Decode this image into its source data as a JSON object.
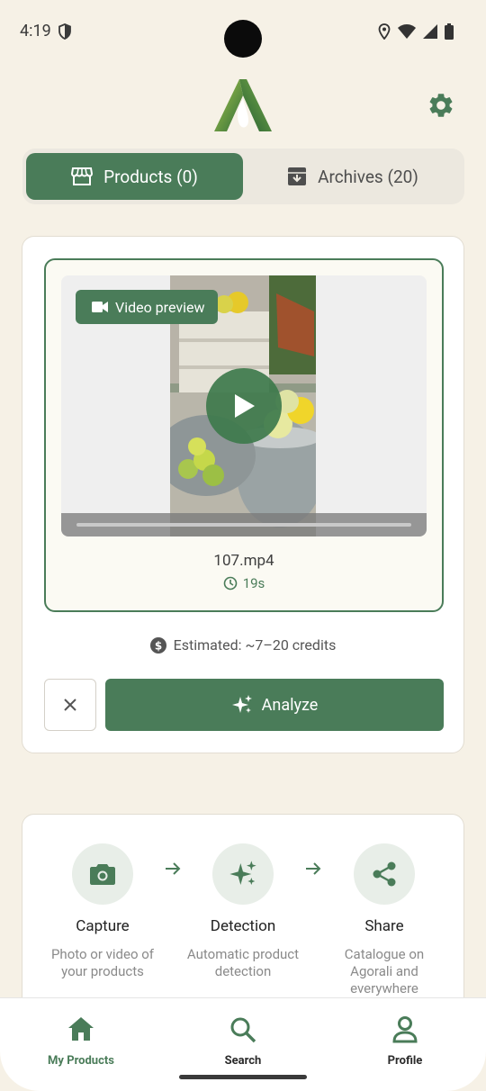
{
  "status_bar": {
    "time": "4:19"
  },
  "tabs": [
    {
      "label": "Products (0)",
      "icon": "storefront-icon",
      "active": true
    },
    {
      "label": "Archives (20)",
      "icon": "archive-icon",
      "active": false
    }
  ],
  "upload": {
    "badge_label": "Video preview",
    "filename": "107.mp4",
    "duration": "19s",
    "estimate": "Estimated: ~7–20 credits",
    "analyze_label": "Analyze"
  },
  "steps": [
    {
      "title": "Capture",
      "desc": "Photo or video of your products",
      "icon": "camera-icon"
    },
    {
      "title": "Detection",
      "desc": "Automatic product detection",
      "icon": "sparkle-icon"
    },
    {
      "title": "Share",
      "desc": "Catalogue on Agorali and everywhere",
      "icon": "share-icon"
    }
  ],
  "nav": [
    {
      "label": "My Products",
      "icon": "home-icon",
      "active": true
    },
    {
      "label": "Search",
      "icon": "search-icon",
      "active": false
    },
    {
      "label": "Profile",
      "icon": "profile-icon",
      "active": false
    }
  ],
  "colors": {
    "accent": "#4a7c59",
    "background": "#f6f1e6",
    "text_inactive": "#2b2b2b"
  }
}
